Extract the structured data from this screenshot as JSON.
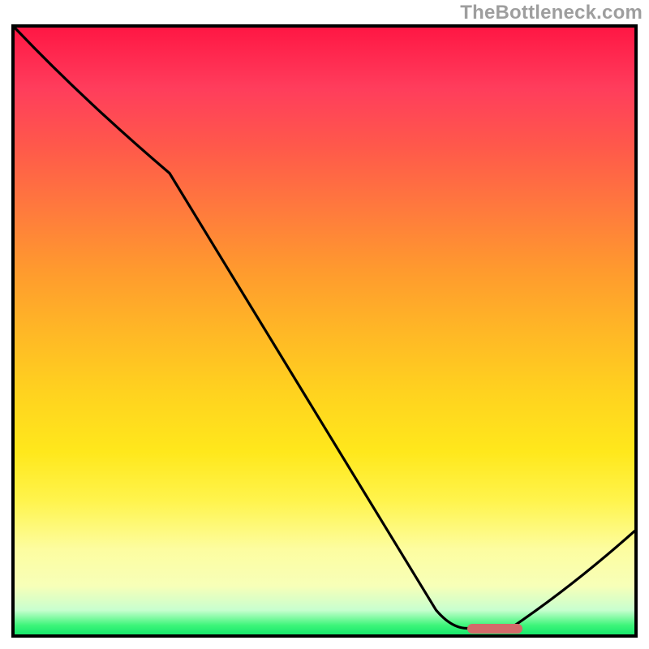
{
  "watermark": "TheBottleneck.com",
  "chart_data": {
    "type": "line",
    "title": "",
    "xlabel": "",
    "ylabel": "",
    "xlim": [
      0,
      100
    ],
    "ylim": [
      0,
      100
    ],
    "series": [
      {
        "name": "curve",
        "x": [
          0,
          25,
          68,
          73,
          80,
          100
        ],
        "values": [
          100,
          76,
          4,
          1,
          1,
          17
        ]
      }
    ],
    "marker": {
      "x_start": 73,
      "x_end": 82,
      "y": 1
    },
    "background_gradient": {
      "stops": [
        {
          "pos": 0.0,
          "color": "#ff1744"
        },
        {
          "pos": 0.5,
          "color": "#ffb726"
        },
        {
          "pos": 0.78,
          "color": "#fff44d"
        },
        {
          "pos": 0.96,
          "color": "#c8ffcf"
        },
        {
          "pos": 1.0,
          "color": "#18e86c"
        }
      ],
      "direction": "top-to-bottom"
    }
  },
  "colors": {
    "curve": "#000000",
    "marker": "#d36a6a",
    "border": "#000000",
    "watermark": "#9e9e9e"
  }
}
